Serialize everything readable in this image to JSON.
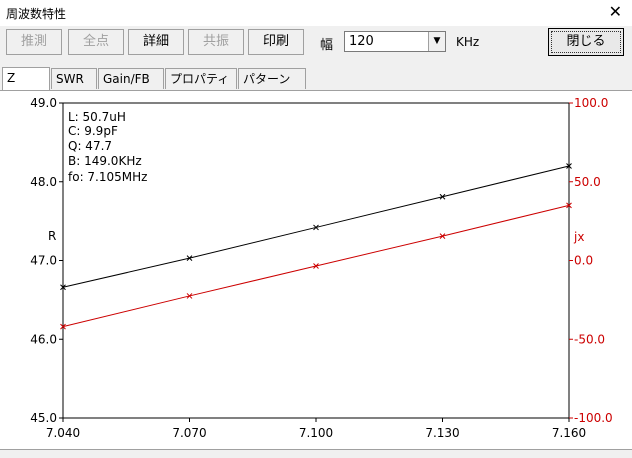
{
  "window": {
    "title": "周波数特性",
    "close_symbol": "✕"
  },
  "toolbar": {
    "buttons": [
      {
        "label": "推測",
        "enabled": false
      },
      {
        "label": "全点",
        "enabled": false
      },
      {
        "label": "詳細",
        "enabled": true
      },
      {
        "label": "共振",
        "enabled": false
      },
      {
        "label": "印刷",
        "enabled": true
      }
    ],
    "width_label": "幅",
    "width_value": "120",
    "unit": "KHz",
    "close_label": "閉じる"
  },
  "tabs": [
    {
      "label": "Z",
      "active": true
    },
    {
      "label": "SWR",
      "active": false
    },
    {
      "label": "Gain/FB",
      "active": false
    },
    {
      "label": "プロパティ",
      "active": false
    },
    {
      "label": "パターン",
      "active": false
    }
  ],
  "info": [
    "L: 50.7uH",
    "C: 9.9pF",
    "Q: 47.7",
    "B: 149.0KHz",
    "fo: 7.105MHz"
  ],
  "colors": {
    "r_series": "#000000",
    "jx_series": "#cc0000"
  },
  "chart_data": {
    "type": "line",
    "x": [
      7.04,
      7.07,
      7.1,
      7.13,
      7.16
    ],
    "x_ticks": [
      "7.040",
      "7.070",
      "7.100",
      "7.130",
      "7.160"
    ],
    "xlim": [
      7.04,
      7.16
    ],
    "left_axis": {
      "label": "R",
      "ylim": [
        45.0,
        49.0
      ],
      "ticks": [
        "45.0",
        "46.0",
        "47.0",
        "48.0",
        "49.0"
      ]
    },
    "right_axis": {
      "label": "jx",
      "ylim": [
        -100.0,
        100.0
      ],
      "ticks": [
        "-100.0",
        "-50.0",
        "0.0",
        "50.0",
        "100.0"
      ]
    },
    "series": [
      {
        "name": "R",
        "axis": "left",
        "color": "#000000",
        "values": [
          46.66,
          47.03,
          47.42,
          47.81,
          48.2
        ]
      },
      {
        "name": "jx",
        "axis": "right",
        "color": "#cc0000",
        "values": [
          -42.0,
          -22.5,
          -3.5,
          15.5,
          35.0
        ]
      }
    ],
    "grid": false
  }
}
